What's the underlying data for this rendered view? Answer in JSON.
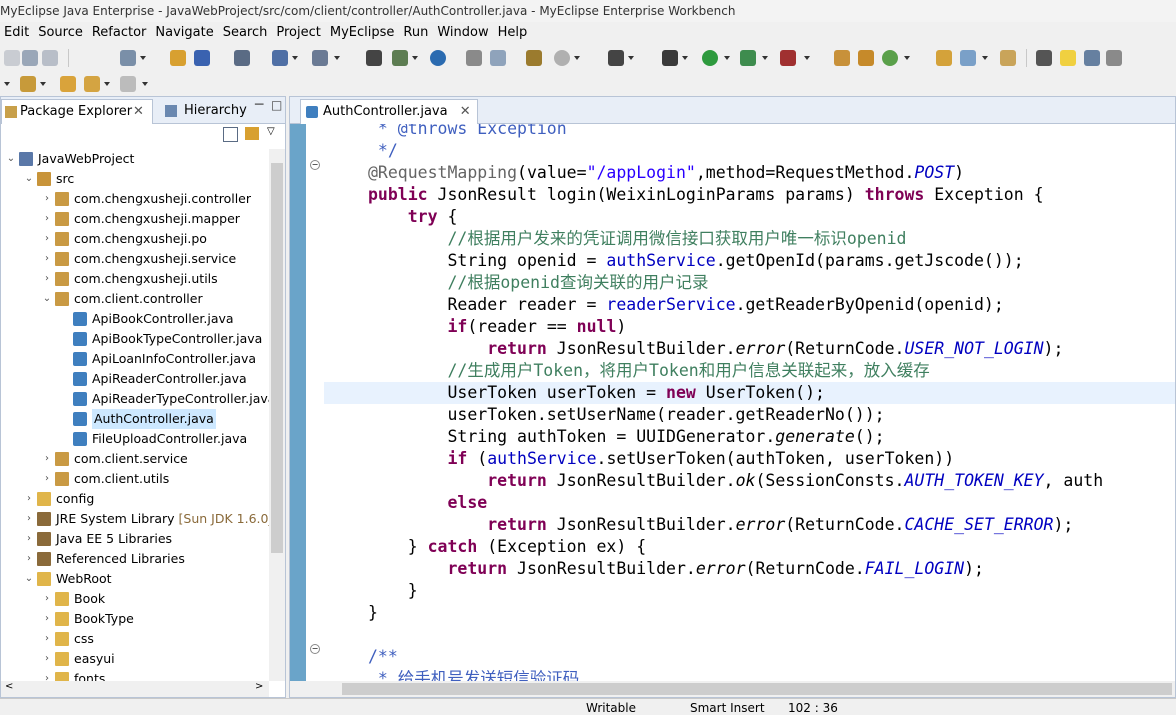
{
  "window": {
    "title": "MyEclipse Java Enterprise - JavaWebProject/src/com/client/controller/AuthController.java - MyEclipse Enterprise Workbench"
  },
  "menu": [
    "Edit",
    "Source",
    "Refactor",
    "Navigate",
    "Search",
    "Project",
    "MyEclipse",
    "Run",
    "Window",
    "Help"
  ],
  "left_panel": {
    "tabs": [
      "Package Explorer",
      "Hierarchy"
    ],
    "tree": [
      {
        "label": "JavaWebProject",
        "icon": "project-icon",
        "expanded": true
      },
      {
        "label": "src",
        "icon": "source-folder-icon",
        "expanded": true
      },
      {
        "label": "com.chengxusheji.controller",
        "icon": "package-icon"
      },
      {
        "label": "com.chengxusheji.mapper",
        "icon": "package-icon"
      },
      {
        "label": "com.chengxusheji.po",
        "icon": "package-icon"
      },
      {
        "label": "com.chengxusheji.service",
        "icon": "package-icon"
      },
      {
        "label": "com.chengxusheji.utils",
        "icon": "package-icon"
      },
      {
        "label": "com.client.controller",
        "icon": "package-icon",
        "expanded": true
      },
      {
        "label": "ApiBookController.java",
        "icon": "java-file-icon"
      },
      {
        "label": "ApiBookTypeController.java",
        "icon": "java-file-icon"
      },
      {
        "label": "ApiLoanInfoController.java",
        "icon": "java-file-icon"
      },
      {
        "label": "ApiReaderController.java",
        "icon": "java-file-icon"
      },
      {
        "label": "ApiReaderTypeController.java",
        "icon": "java-file-icon"
      },
      {
        "label": "AuthController.java",
        "icon": "java-file-icon",
        "selected": true
      },
      {
        "label": "FileUploadController.java",
        "icon": "java-file-icon"
      },
      {
        "label": "com.client.service",
        "icon": "package-icon"
      },
      {
        "label": "com.client.utils",
        "icon": "package-icon"
      },
      {
        "label": "config",
        "icon": "folder-icon"
      },
      {
        "label": "JRE System Library",
        "suffix": "[Sun JDK 1.6.0_1",
        "icon": "library-icon"
      },
      {
        "label": "Java EE 5 Libraries",
        "icon": "library-icon"
      },
      {
        "label": "Referenced Libraries",
        "icon": "library-icon"
      },
      {
        "label": "WebRoot",
        "icon": "folder-icon",
        "expanded": true
      },
      {
        "label": "Book",
        "icon": "folder-icon"
      },
      {
        "label": "BookType",
        "icon": "folder-icon"
      },
      {
        "label": "css",
        "icon": "folder-icon"
      },
      {
        "label": "easyui",
        "icon": "folder-icon"
      },
      {
        "label": "fonts",
        "icon": "folder-icon"
      }
    ]
  },
  "editor": {
    "tab_label": "AuthController.java",
    "lines": [
      " * @throws Exception",
      " */",
      "@RequestMapping(value=\"/appLogin\",method=RequestMethod.POST)",
      "public JsonResult login(WeixinLoginParams params) throws Exception {",
      "    try {",
      "        //根据用户发来的凭证调用微信接口获取用户唯一标识openid",
      "        String openid = authService.getOpenId(params.getJscode());",
      "        //根据openid查询关联的用户记录",
      "        Reader reader = readerService.getReaderByOpenid(openid);",
      "        if(reader == null)",
      "            return JsonResultBuilder.error(ReturnCode.USER_NOT_LOGIN);",
      "        //生成用户Token，将用户Token和用户信息关联起来，放入缓存",
      "        UserToken userToken = new UserToken();",
      "        userToken.setUserName(reader.getReaderNo());",
      "        String authToken = UUIDGenerator.generate();",
      "        if (authService.setUserToken(authToken, userToken))",
      "            return JsonResultBuilder.ok(SessionConsts.AUTH_TOKEN_KEY, auth",
      "        else",
      "            return JsonResultBuilder.error(ReturnCode.CACHE_SET_ERROR);",
      "    } catch (Exception ex) {",
      "        return JsonResultBuilder.error(ReturnCode.FAIL_LOGIN);",
      "    }",
      "}",
      "",
      "/**",
      " * 给手机号发送短信验证码"
    ]
  },
  "status": {
    "writable": "Writable",
    "insert_mode": "Smart Insert",
    "position": "102 : 36"
  },
  "colors": {
    "keyword": "#7f0055",
    "comment": "#3f7f5f",
    "string": "#2a00ff",
    "field": "#0000c0",
    "annotation": "#646464",
    "current_line": "#e8f2fe",
    "ruler": "#6aa4c9"
  }
}
